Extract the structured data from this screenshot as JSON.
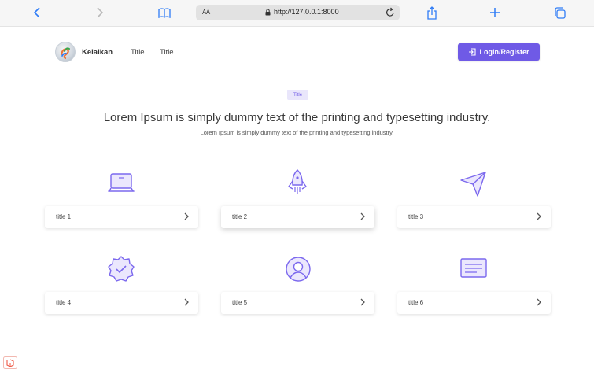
{
  "browser": {
    "text_size_label": "AA",
    "url": "http://127.0.0.1:8000",
    "icons": [
      "back-icon",
      "forward-icon",
      "bookmarks-icon",
      "lock-icon",
      "reload-icon",
      "share-icon",
      "new-tab-icon",
      "tabs-icon"
    ]
  },
  "nav": {
    "brand": "Kelaikan",
    "links": [
      "Title",
      "Title"
    ],
    "login_label": "Login/Register"
  },
  "hero": {
    "badge": "Title",
    "headline": "Lorem Ipsum is simply dummy text of the printing and typesetting industry.",
    "subline": "Lorem Ipsum is simply dummy text of the printing and typesetting industry."
  },
  "features": [
    {
      "title": "title 1",
      "icon": "laptop-icon"
    },
    {
      "title": "title 2",
      "icon": "rocket-icon"
    },
    {
      "title": "title 3",
      "icon": "paper-plane-icon"
    },
    {
      "title": "title 4",
      "icon": "verified-badge-icon"
    },
    {
      "title": "title 5",
      "icon": "user-circle-icon"
    },
    {
      "title": "title 6",
      "icon": "document-icon"
    }
  ],
  "colors": {
    "accent": "#6f5ae6",
    "icon_stroke": "#7b68ee",
    "badge_bg": "#e9e6fb"
  }
}
